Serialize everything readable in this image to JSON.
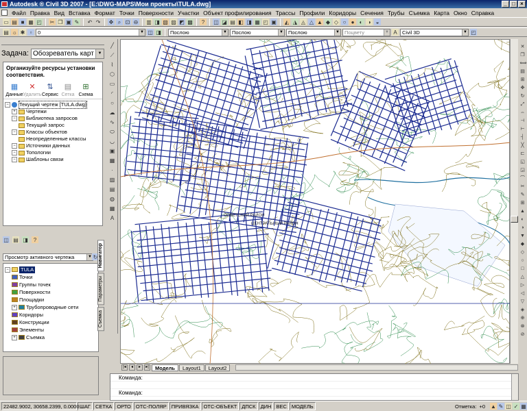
{
  "window": {
    "title": "Autodesk ® Civil 3D 2007 - [E:\\DWG-MAPS\\Мои проекты\\TULA.dwg]"
  },
  "menu": [
    "Файл",
    "Правка",
    "Вид",
    "Вставка",
    "Формат",
    "Точки",
    "Поверхности",
    "Участки",
    "Объект профилирования",
    "Трассы",
    "Профили",
    "Коридоры",
    "Сечения",
    "Трубы",
    "Съемка",
    "Карта",
    "Окно",
    "Справка"
  ],
  "toolbar2": {
    "layer_combo": "0",
    "color_combo": "Послою",
    "linetype_combo": "Послою",
    "lineweight_combo": "Послою",
    "plot_combo": "Поцвету",
    "style_combo": "Civil 3D"
  },
  "task": {
    "label": "Задача:",
    "value": "Обозреватель карт"
  },
  "map_explorer": {
    "hint": "Организуйте ресурсы установки соответствия.",
    "tools": [
      {
        "label": "Данные",
        "icon": "data-icon"
      },
      {
        "label": "Удалить",
        "icon": "delete-icon"
      },
      {
        "label": "Сервис",
        "icon": "tools-icon"
      },
      {
        "label": "Сетка",
        "icon": "grid-icon"
      },
      {
        "label": "Схема",
        "icon": "schema-icon"
      }
    ],
    "tree": [
      {
        "label": "Текущий чертеж [TULA.dwg]",
        "level": 0
      },
      {
        "label": "Чертежи",
        "level": 1
      },
      {
        "label": "Библиотека запросов",
        "level": 1
      },
      {
        "label": "Текущий запрос",
        "level": 2
      },
      {
        "label": "Классы объектов",
        "level": 1
      },
      {
        "label": "Неопределенные классы",
        "level": 2
      },
      {
        "label": "Источники данных",
        "level": 1
      },
      {
        "label": "Топологии",
        "level": 1
      },
      {
        "label": "Шаблоны связи",
        "level": 1
      }
    ]
  },
  "prospector": {
    "combo": "Просмотр активного чертежа",
    "tree": [
      {
        "label": "TULA",
        "level": 0
      },
      {
        "label": "Точки",
        "level": 1
      },
      {
        "label": "Группы точек",
        "level": 1
      },
      {
        "label": "Поверхности",
        "level": 1
      },
      {
        "label": "Площадки",
        "level": 1
      },
      {
        "label": "Трубопроводные сети",
        "level": 1
      },
      {
        "label": "Коридоры",
        "level": 1
      },
      {
        "label": "Конструкции",
        "level": 1
      },
      {
        "label": "Элементы",
        "level": 1
      },
      {
        "label": "Съемка",
        "level": 1
      }
    ],
    "tabs": [
      "Навигатор",
      "Параметры",
      "Съемка"
    ]
  },
  "layouts": {
    "tabs": [
      "Модель",
      "Layout1",
      "Layout2"
    ],
    "active": 0
  },
  "command": {
    "lines": [
      "Команда:",
      "",
      "Команда:"
    ]
  },
  "status": {
    "coords": "22482.9002, 30658.2399, 0.0000",
    "toggles": [
      "ШАГ",
      "СЕТКА",
      "ОРТО",
      "ОТС-ПОЛЯР",
      "ПРИВЯЗКА",
      "ОТС-ОБЪЕКТ",
      "ДПСК",
      "ДИН",
      "ВЕС",
      "МОДЕЛЬ"
    ],
    "scale_label": "Отметка:",
    "scale_value": "+0"
  },
  "map_labels": [
    "СОВЕТСКИЙ РАЙОН",
    "ЦЕНТРАЛЬНЫЙ РАЙОН"
  ],
  "colors": {
    "streets": "#1a2a90",
    "contours": "#7a6a10",
    "water": "#2070a0"
  }
}
